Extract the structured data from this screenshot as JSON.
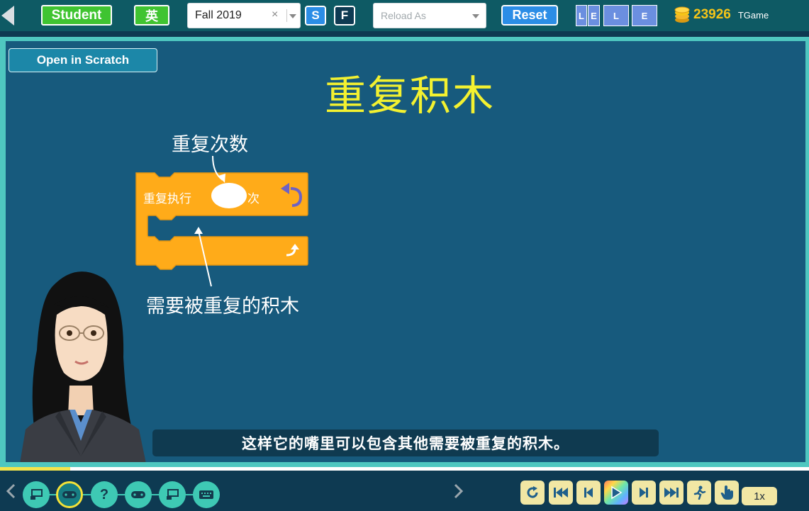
{
  "topbar": {
    "role_label": "Student",
    "language_label": "英",
    "term_select": {
      "value": "Fall 2019"
    },
    "s_label": "S",
    "f_label": "F",
    "reload_select": {
      "placeholder": "Reload As"
    },
    "reset_label": "Reset",
    "levels": [
      "L",
      "E",
      "L",
      "E"
    ],
    "coin_count": "23926",
    "game_label": "TGame"
  },
  "stage": {
    "open_scratch_label": "Open in Scratch",
    "title": "重复积木",
    "label_repeat_count": "重复次数",
    "label_repeated_blocks": "需要被重复的积木",
    "block": {
      "repeat_text": "重复执行",
      "times_text": "次"
    },
    "subtitle": "这样它的嘴里可以包含其他需要被重复的积木。"
  },
  "progress": {
    "fraction": 0.087
  },
  "bottombar": {
    "lessons": [
      {
        "icon": "presentation-icon",
        "active": false
      },
      {
        "icon": "gamepad-icon",
        "active": true
      },
      {
        "icon": "question-icon",
        "active": false
      },
      {
        "icon": "gamepad-icon",
        "active": false
      },
      {
        "icon": "presentation-icon",
        "active": false
      },
      {
        "icon": "keyboard-icon",
        "active": false
      }
    ],
    "controls": [
      "replay-icon",
      "first-step-icon",
      "prev-step-icon",
      "play-icon",
      "next-step-icon",
      "last-step-icon",
      "run-icon",
      "hand-icon"
    ],
    "speed_label": "1x"
  },
  "colors": {
    "topbar_bg": "#0e5a64",
    "stage_bg": "#175a7d",
    "frame": "#4fc7c0",
    "title": "#f3f130",
    "block_orange": "#ffab19",
    "accent_green": "#3fc431",
    "accent_blue": "#2b8de6"
  }
}
